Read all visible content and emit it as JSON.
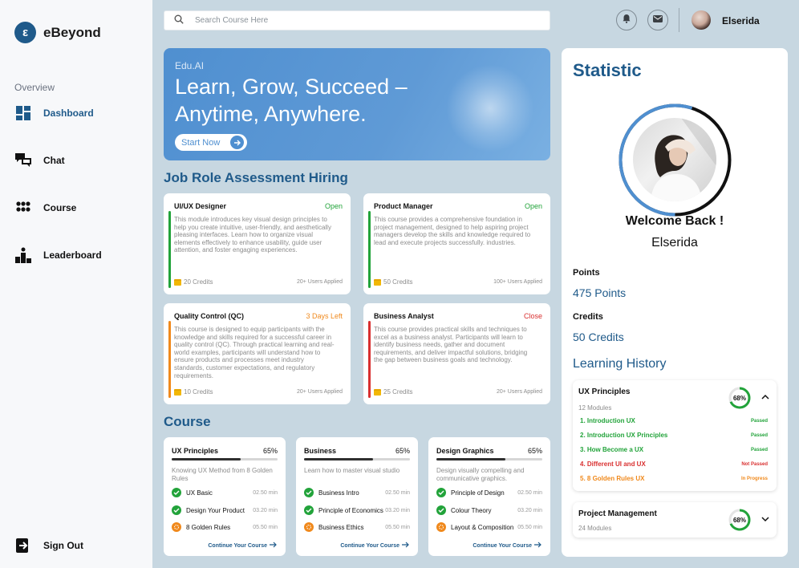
{
  "brand": {
    "logo_letter": "ε",
    "name": "eBeyond"
  },
  "sidebar": {
    "section": "Overview",
    "items": [
      {
        "label": "Dashboard",
        "icon": "dashboard-icon"
      },
      {
        "label": "Chat",
        "icon": "chat-icon"
      },
      {
        "label": "Course",
        "icon": "course-icon"
      },
      {
        "label": "Leaderboard",
        "icon": "leaderboard-icon"
      }
    ],
    "signout": "Sign Out"
  },
  "topbar": {
    "search_placeholder": "Search Course Here",
    "user_name": "Elserida"
  },
  "hero": {
    "tag": "Edu.AI",
    "title": "Learn, Grow, Succeed – Anytime, Anywhere.",
    "button": "Start Now"
  },
  "jobs": {
    "title": "Job Role Assessment Hiring",
    "cards": [
      {
        "title": "UI/UX Designer",
        "status": "Open",
        "status_color": "#22a33a",
        "bar_color": "#22a33a",
        "desc": "This module introduces key visual design principles to help you create intuitive, user-friendly, and aesthetically pleasing interfaces. Learn how to organize visual elements effectively to enhance usability, guide user attention, and foster engaging experiences.",
        "credits": "20 Credits",
        "users": "20+ Users Applied"
      },
      {
        "title": "Product Manager",
        "status": "Open",
        "status_color": "#22a33a",
        "bar_color": "#22a33a",
        "desc": "This course provides a comprehensive foundation in project management, designed to help aspiring project managers develop the skills and knowledge required to lead and execute projects successfully. industries.",
        "credits": "50 Credits",
        "users": "100+ Users Applied"
      },
      {
        "title": "Quality Control (QC)",
        "status": "3 Days Left",
        "status_color": "#f0891c",
        "bar_color": "#f0891c",
        "desc": "This course is designed to equip participants with the knowledge and skills required for a successful career in quality control (QC). Through practical learning and real-world examples, participants will understand how to ensure products and processes meet industry standards, customer expectations, and regulatory requirements.",
        "credits": "10 Credits",
        "users": "20+ Users Applied"
      },
      {
        "title": "Business Analyst",
        "status": "Close",
        "status_color": "#d93030",
        "bar_color": "#d93030",
        "desc": "This course provides practical skills and techniques to excel as a business analyst. Participants will learn to identify business needs, gather and document requirements, and deliver impactful solutions, bridging the gap between business goals and technology.",
        "credits": "25 Credits",
        "users": "20+ Users Applied"
      }
    ]
  },
  "courses": {
    "title": "Course",
    "link": "Continue Your Course",
    "cards": [
      {
        "title": "UX Principles",
        "percent": "65%",
        "progress": 0.65,
        "desc": "Knowing UX Method from 8 Golden Rules",
        "lessons": [
          {
            "name": "UX Basic",
            "time": "02.50 min",
            "state": "done"
          },
          {
            "name": "Design Your Product",
            "time": "03.20 min",
            "state": "done"
          },
          {
            "name": "8 Golden Rules",
            "time": "05.50 min",
            "state": "progress"
          }
        ]
      },
      {
        "title": "Business",
        "percent": "65%",
        "progress": 0.65,
        "desc": "Learn how to master visual studio",
        "lessons": [
          {
            "name": "Business Intro",
            "time": "02.50 min",
            "state": "done"
          },
          {
            "name": "Principle of Economics",
            "time": "03.20 min",
            "state": "done"
          },
          {
            "name": "Business Ethics",
            "time": "05.50 min",
            "state": "progress"
          }
        ]
      },
      {
        "title": "Design Graphics",
        "percent": "65%",
        "progress": 0.65,
        "desc": "Design visually compelling and communicative graphics.",
        "lessons": [
          {
            "name": "Principle of Design",
            "time": "02.50 min",
            "state": "done"
          },
          {
            "name": "Colour Theory",
            "time": "03.20 min",
            "state": "done"
          },
          {
            "name": "Layout & Composition",
            "time": "05.50 min",
            "state": "progress"
          }
        ]
      }
    ]
  },
  "statistic": {
    "title": "Statistic",
    "welcome": "Welcome Back !",
    "name": "Elserida",
    "profile_progress": 0.55,
    "points_label": "Points",
    "points_value": "475 Points",
    "credits_label": "Credits",
    "credits_value": "50 Credits",
    "history_title": "Learning History",
    "history": [
      {
        "name": "UX Principles",
        "modules": "12 Modules",
        "percent": "68%",
        "progress": 0.68,
        "expanded": true,
        "rows": [
          {
            "label": "1. Introduction UX",
            "status": "Passed",
            "color": "#22a33a"
          },
          {
            "label": "2. Introduction UX Principles",
            "status": "Passed",
            "color": "#22a33a"
          },
          {
            "label": "3. How Become a UX",
            "status": "Passed",
            "color": "#22a33a"
          },
          {
            "label": "4. Different UI and UX",
            "status": "Not Passed",
            "color": "#d93030"
          },
          {
            "label": "5. 8 Golden Rules UX",
            "status": "In Progress",
            "color": "#f0891c"
          }
        ]
      },
      {
        "name": "Project Management",
        "modules": "24 Modules",
        "percent": "68%",
        "progress": 0.68,
        "expanded": false,
        "rows": []
      }
    ]
  }
}
